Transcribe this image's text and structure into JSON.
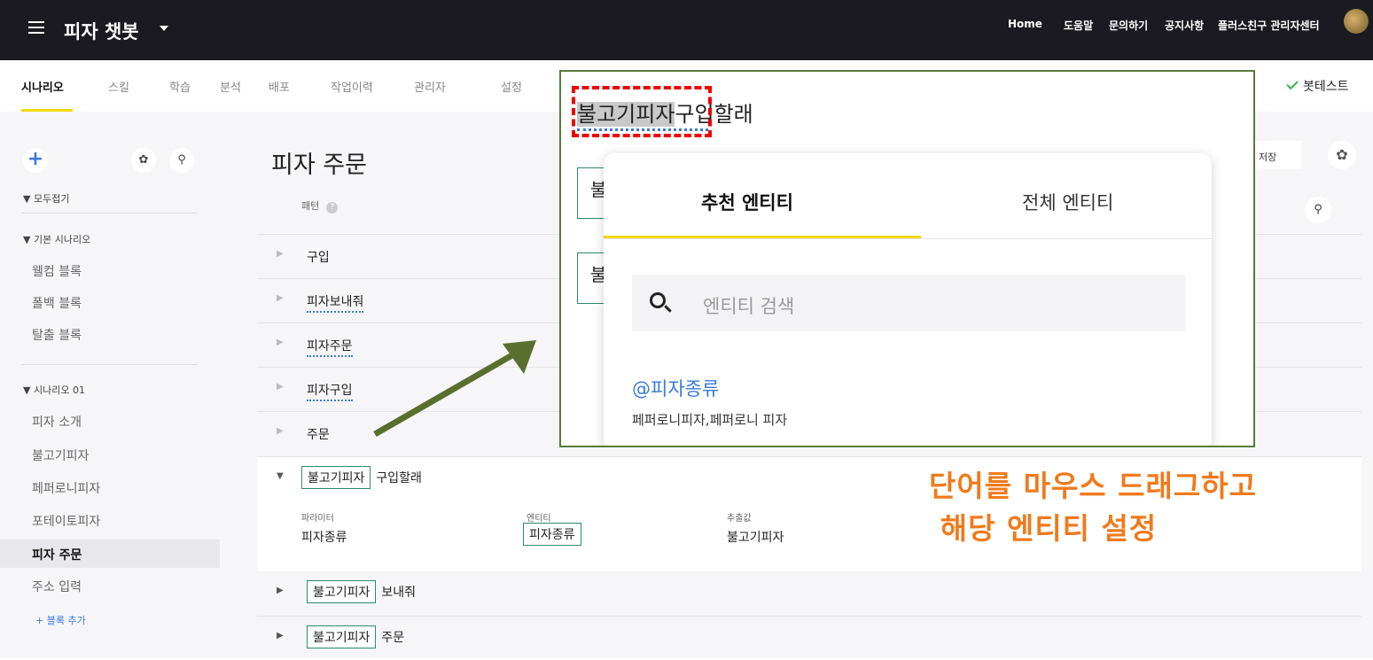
{
  "header": {
    "app_title": "피자 챗봇",
    "links": [
      "Home",
      "도움말",
      "문의하기",
      "공지사항",
      "플러스친구 관리자센터"
    ]
  },
  "tabs": [
    "시나리오",
    "스킬",
    "학습",
    "분석",
    "배포",
    "작업이력",
    "관리자",
    "설정"
  ],
  "active_tab": "시나리오",
  "bottest_label": "봇테스트",
  "sidebar": {
    "collapse_all": "모두접기",
    "group_basic": "기본 시나리오",
    "basic_items": [
      "웰컴 블록",
      "폴백 블록",
      "탈출 블록"
    ],
    "group_scenario": "시나리오 01",
    "scenario_items": [
      "피자 소개",
      "불고기피자",
      "페퍼로니피자",
      "포테이토피자",
      "피자 주문",
      "주소 입력"
    ],
    "selected": "피자 주문",
    "add_block": "+ 블록 추가"
  },
  "main": {
    "title": "피자 주문",
    "save_label": "저장",
    "pattern_header": "패턴",
    "help": "?",
    "rows": [
      "구입",
      "피자보내줘",
      "피자주문",
      "피자구입",
      "주문"
    ],
    "expanded": {
      "entity_tag": "불고기피자",
      "rest": "구입할래",
      "param_header": "파라미터",
      "entity_header": "엔티티",
      "value_header": "추출값",
      "param_value": "피자종류",
      "entity_value": "피자종류",
      "extract_value": "불고기피자"
    },
    "bottom_rows": [
      {
        "tag": "불고기피자",
        "rest": "보내줘"
      },
      {
        "tag": "불고기피자",
        "rest": "주문"
      }
    ]
  },
  "popup": {
    "highlight": "불고기피자",
    "rest": "구입할래",
    "slot_char": "불",
    "tab_recommended": "추천 엔티티",
    "tab_all": "전체 엔티티",
    "search_placeholder": "엔티티 검색",
    "entity_name": "@피자종류",
    "entity_values": "페퍼로니피자,페퍼로니 피자"
  },
  "annotation": {
    "line1": "단어를 마우스 드래그하고",
    "line2": "해당 엔티티 설정"
  },
  "colors": {
    "accent_yellow": "#f5d800",
    "link_blue": "#3a7bd5",
    "entity_border": "#2e8a6a",
    "annotation_orange": "#f07a1c",
    "arrow_green": "#5a6e2e",
    "drag_outline_red": "#e00000"
  }
}
